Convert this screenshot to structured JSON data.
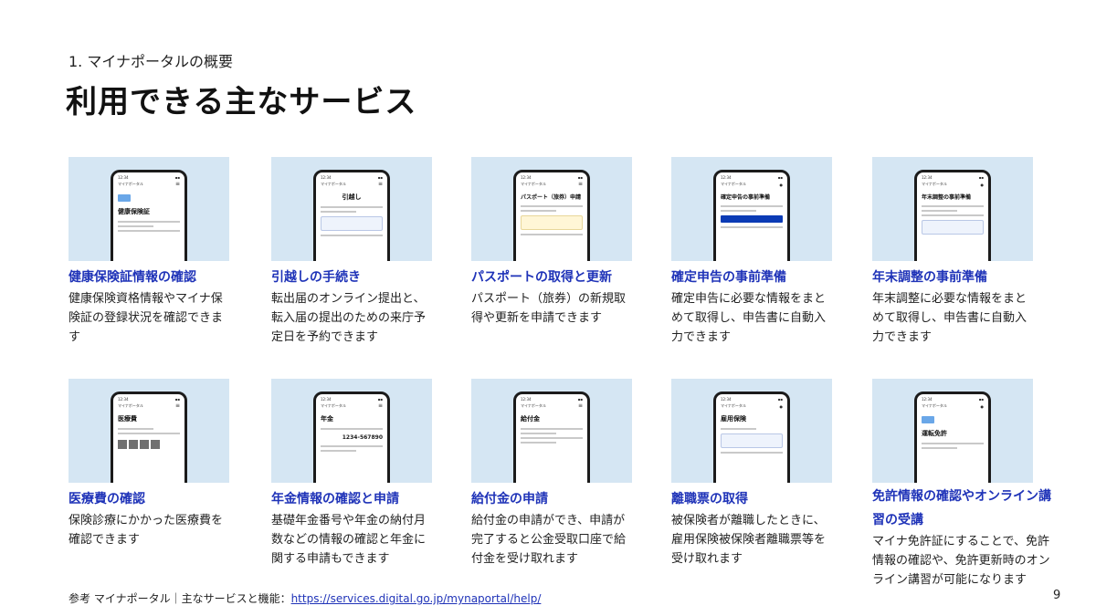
{
  "header": {
    "section": "1. マイナポータルの概要",
    "title": "利用できる主なサービス"
  },
  "phone_common": {
    "time": "12:34",
    "app": "マイナポータル"
  },
  "services": [
    {
      "title": "健康保険証情報の確認",
      "desc": "健康保険資格情報やマイナ保険証の登録状況を確認できます",
      "screen": "健康保険証"
    },
    {
      "title": "引越しの手続き",
      "desc": "転出届のオンライン提出と、転入届の提出のための来庁予定日を予約できます",
      "screen": "引越し"
    },
    {
      "title": "パスポートの取得と更新",
      "desc": "パスポート（旅券）の新規取得や更新を申請できます",
      "screen": "パスポート（旅券）申請"
    },
    {
      "title": "確定申告の事前準備",
      "desc": "確定申告に必要な情報をまとめて取得し、申告書に自動入力できます",
      "screen": "確定申告の事前準備"
    },
    {
      "title": "年末調整の事前準備",
      "desc": "年末調整に必要な情報をまとめて取得し、申告書に自動入力できます",
      "screen": "年末調整の事前準備"
    },
    {
      "title": "医療費の確認",
      "desc": "保険診療にかかった医療費を確認できます",
      "screen": "医療費"
    },
    {
      "title": "年金情報の確認と申請",
      "desc": "基礎年金番号や年金の納付月数などの情報の確認と年金に関する申請もできます",
      "screen": "年金",
      "number": "1234-567890"
    },
    {
      "title": "給付金の申請",
      "desc": "給付金の申請ができ、申請が完了すると公金受取口座で給付金を受け取れます",
      "screen": "給付金"
    },
    {
      "title": "離職票の取得",
      "desc": "被保険者が離職したときに、雇用保険被保険者離職票等を受け取れます",
      "screen": "雇用保険"
    },
    {
      "title": "免許情報の確認やオンライン講習の受講",
      "desc": "マイナ免許証にすることで、免許情報の確認や、免許更新時のオンライン講習が可能になります",
      "screen": "運転免許"
    }
  ],
  "footer": {
    "prefix": "参考 マイナポータル｜主なサービスと機能：",
    "link": "https://services.digital.go.jp/mynaportal/help/"
  },
  "page_number": "9"
}
